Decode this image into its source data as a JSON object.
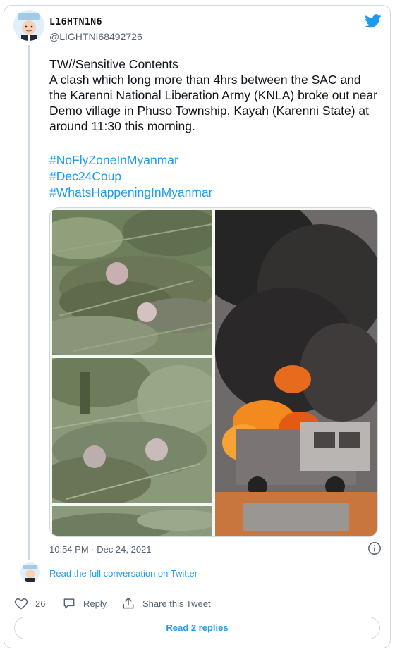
{
  "author": {
    "display_name": "L16HTN1N6",
    "handle": "@LIGHTNI68492726"
  },
  "tweet": {
    "text_lines": [
      "TW//Sensitive Contents",
      "A clash which long more than 4hrs between the SAC and the Karenni National Liberation Army (KNLA) broke out near Demo village in Phuso Township, Kayah (Karenni State) at around 11:30 this morning."
    ],
    "hashtags": [
      "#NoFlyZoneInMyanmar",
      "#Dec24Coup",
      "#WhatsHappeningInMyanmar"
    ],
    "timestamp": "10:54 PM · Dec 24, 2021"
  },
  "conversation": {
    "read_full_label": "Read the full conversation on Twitter"
  },
  "actions": {
    "like_count": "26",
    "reply_label": "Reply",
    "share_label": "Share this Tweet"
  },
  "replies": {
    "button_label": "Read 2 replies"
  },
  "icons": {
    "brand": "twitter-bird-icon",
    "info": "info-icon",
    "like": "heart-icon",
    "reply": "speech-bubble-icon",
    "share": "share-upload-icon"
  },
  "colors": {
    "accent": "#1d9bf0",
    "secondary_text": "#536471",
    "border": "#cfd9de"
  }
}
